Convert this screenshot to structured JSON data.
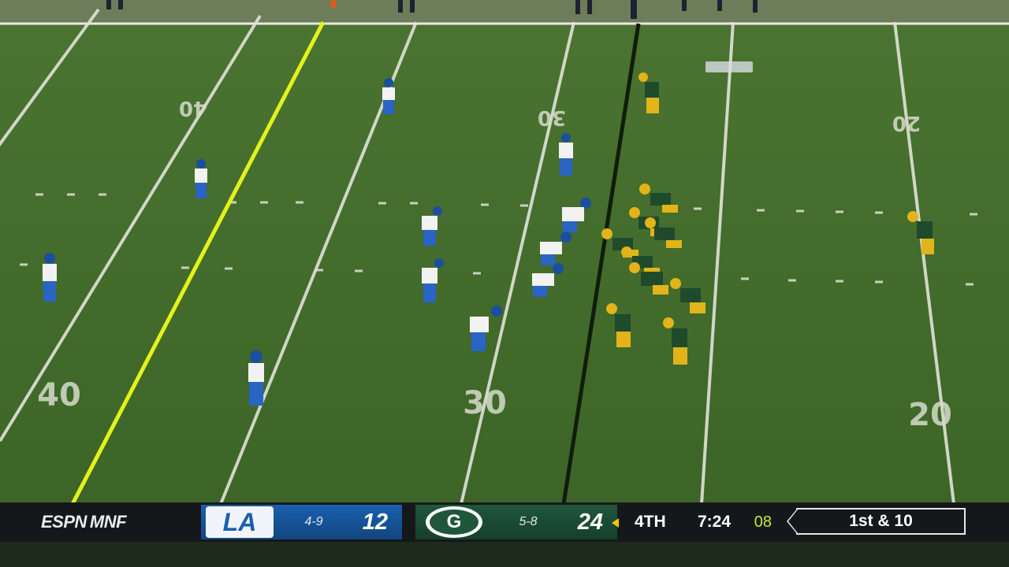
{
  "broadcast": {
    "network": "ESPN",
    "show": "MNF"
  },
  "away_team": {
    "abbr": "LA",
    "record": "4-9",
    "score": "12"
  },
  "home_team": {
    "abbr": "G",
    "record": "5-8",
    "score": "24",
    "possession": true
  },
  "game": {
    "quarter": "4TH",
    "clock": "7:24",
    "play_clock": "08",
    "down_distance": "1st & 10"
  },
  "field_numbers": {
    "left_top": "40",
    "center_top": "30",
    "right_top": "20",
    "left_bottom": "40",
    "center_bottom": "30",
    "right_bottom": "20"
  },
  "colors": {
    "away": "#1a5fae",
    "home": "#20573b",
    "field": "#3f6a2a",
    "first_down_line": "#e3f21a",
    "scrimmage_line": "#0f1d0c"
  }
}
